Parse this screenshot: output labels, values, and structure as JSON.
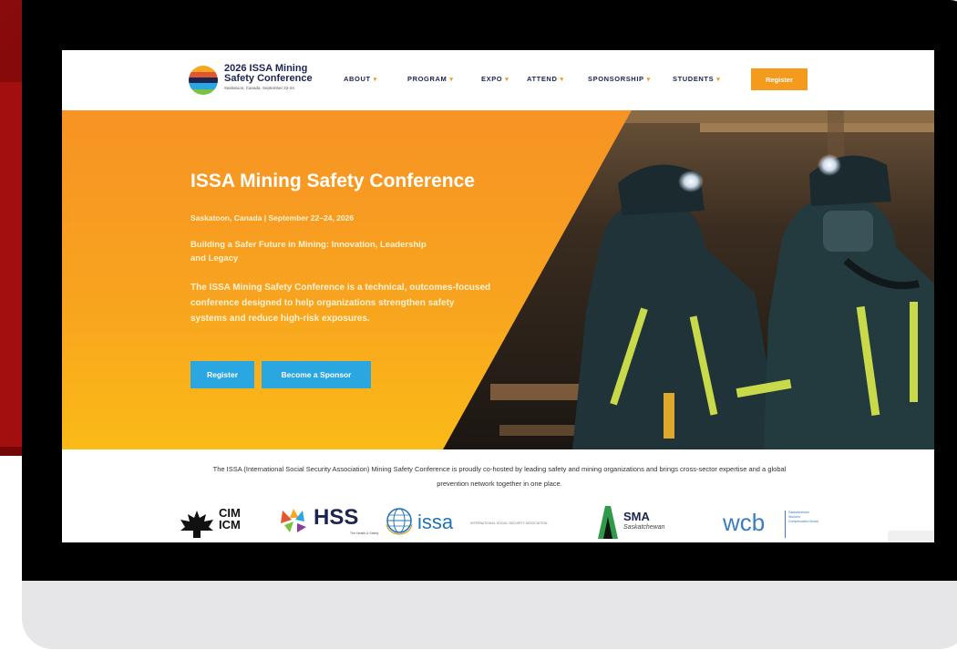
{
  "nav": {
    "logo": {
      "title": "2026 ISSA Mining Safety Conference",
      "subtitle": "Saskatoon, Canada. September 22-24."
    },
    "items": [
      {
        "label": "ABOUT"
      },
      {
        "label": "PROGRAM"
      },
      {
        "label": "EXPO"
      },
      {
        "label": "ATTEND"
      },
      {
        "label": "SPONSORSHIP"
      },
      {
        "label": "STUDENTS"
      }
    ],
    "caret": "▾",
    "register_label": "Register"
  },
  "hero": {
    "title": "ISSA Mining Safety Conference",
    "dates": "Saskatoon, Canada | September 22–24, 2026",
    "tagline": "Building a Safer Future in Mining: Innovation, Leadership and Legacy",
    "description": "The ISSA Mining Safety Conference is a technical, outcomes-focused conference designed to help organizations strengthen safety systems and reduce high-risk exposures.",
    "register_label": "Register",
    "sponsor_label": "Become a Sponsor"
  },
  "intro": {
    "text": "The ISSA (International Social Security Association) Mining Safety Conference is proudly co-hosted by leading safety and mining organizations and brings cross-sector expertise and a global prevention network together in one place."
  },
  "partners": {
    "cim": "CIM ICM",
    "hss": "HSS",
    "hss_sub": "The Health & Safety",
    "issa": "issa",
    "issa_sub": "INTERNATIONAL SOCIAL SECURITY ASSOCIATION",
    "sma": "SMA",
    "sma_sub": "Saskatchewan",
    "wcb": "wcb",
    "wcb_sub": "Saskatchewan Workers' Compensation Board"
  },
  "colors": {
    "accent": "#f49a1d",
    "button_blue": "#2aa6e0",
    "navy": "#1c2452",
    "backdrop_red": "#8a0b0b"
  }
}
